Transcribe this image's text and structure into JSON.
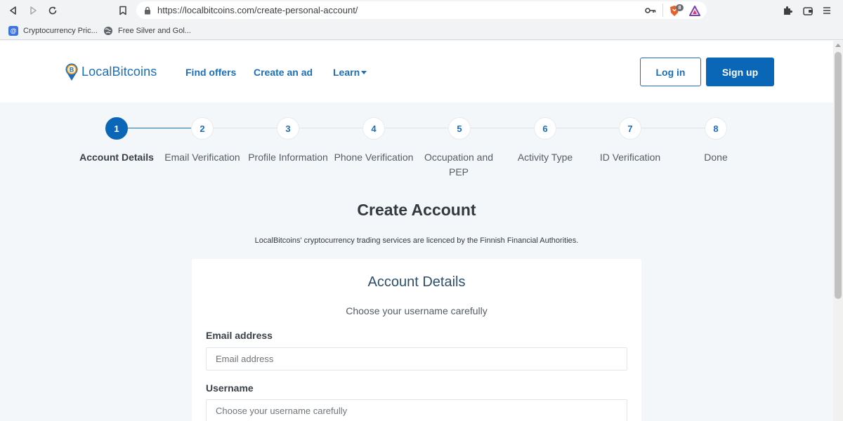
{
  "browser": {
    "url": "https://localbitcoins.com/create-personal-account/",
    "brave_badge": "8",
    "bookmarks": [
      {
        "label": "Cryptocurrency Pric..."
      },
      {
        "label": "Free Silver and Gol..."
      }
    ]
  },
  "header": {
    "logo_text": "LocalBitcoins",
    "nav": [
      "Find offers",
      "Create an ad",
      "Learn"
    ],
    "login_label": "Log in",
    "signup_label": "Sign up"
  },
  "stepper": {
    "active_step": 1,
    "steps": [
      {
        "number": "1",
        "label": "Account Details"
      },
      {
        "number": "2",
        "label": "Email Verification"
      },
      {
        "number": "3",
        "label": "Profile Information"
      },
      {
        "number": "4",
        "label": "Phone Verification"
      },
      {
        "number": "5",
        "label": "Occupation and PEP"
      },
      {
        "number": "6",
        "label": "Activity Type"
      },
      {
        "number": "7",
        "label": "ID Verification"
      },
      {
        "number": "8",
        "label": "Done"
      }
    ]
  },
  "main": {
    "title": "Create Account",
    "licence": "LocalBitcoins' cryptocurrency trading services are licenced by the Finnish Financial Authorities."
  },
  "form": {
    "title": "Account Details",
    "subtitle": "Choose your username carefully",
    "email_label": "Email address",
    "email_placeholder": "Email address",
    "email_value": "",
    "username_label": "Username",
    "username_placeholder": "Choose your username carefully",
    "username_value": ""
  },
  "colors": {
    "brand": "#1c6fb8",
    "brand_dark": "#0a67b8",
    "page_bg": "#f3f7fa"
  }
}
